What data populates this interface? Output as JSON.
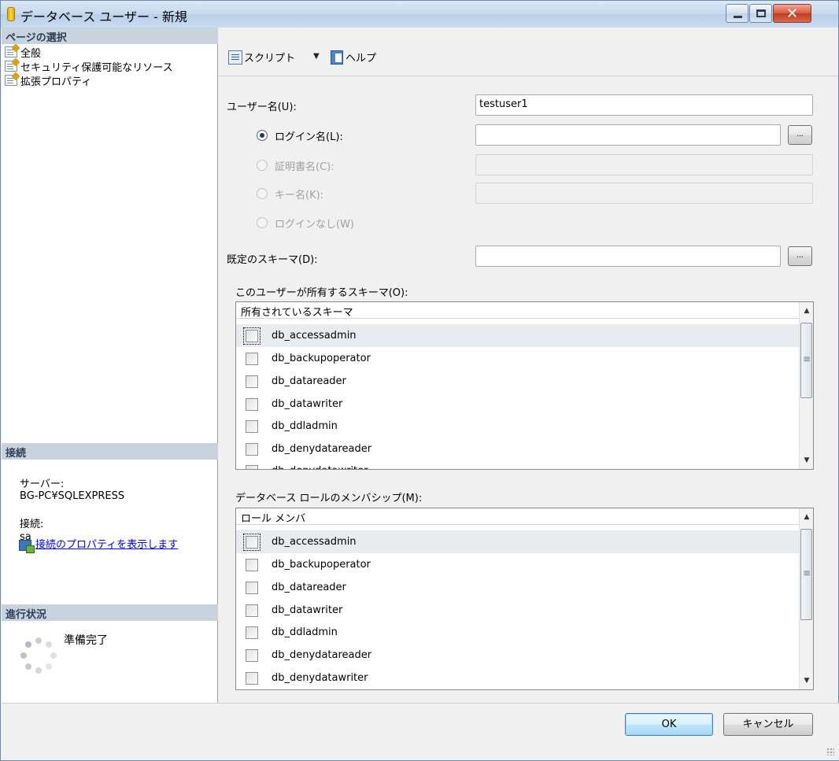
{
  "window": {
    "title": "データベース ユーザー - 新規"
  },
  "left": {
    "pages_header": "ページの選択",
    "pages": [
      {
        "label": "全般"
      },
      {
        "label": "セキュリティ保護可能なリソース"
      },
      {
        "label": "拡張プロパティ"
      }
    ],
    "connection_header": "接続",
    "server_label": "サーバー:",
    "server_value": "BG-PC¥SQLEXPRESS",
    "connection_label": "接続:",
    "connection_value": "sa",
    "view_connection_link": "接続のプロパティを表示します",
    "progress_header": "進行状況",
    "progress_status": "準備完了"
  },
  "toolbar": {
    "script_label": "スクリプト",
    "help_label": "ヘルプ"
  },
  "form": {
    "username_label": "ユーザー名(U):",
    "username_value": "testuser1",
    "login_name_label": "ログイン名(L):",
    "login_name_value": "",
    "cert_name_label": "証明書名(C):",
    "key_name_label": "キー名(K):",
    "no_login_label": "ログインなし(W)",
    "default_schema_label": "既定のスキーマ(D):",
    "default_schema_value": "",
    "browse_label": "...",
    "owned_schemas_label": "このユーザーが所有するスキーマ(O):",
    "owned_schemas_header": "所有されているスキーマ",
    "owned_schemas": [
      {
        "name": "db_accessadmin",
        "checked": false
      },
      {
        "name": "db_backupoperator",
        "checked": false
      },
      {
        "name": "db_datareader",
        "checked": false
      },
      {
        "name": "db_datawriter",
        "checked": false
      },
      {
        "name": "db_ddladmin",
        "checked": false
      },
      {
        "name": "db_denydatareader",
        "checked": false
      },
      {
        "name": "db_denydatawriter",
        "checked": false
      }
    ],
    "role_membership_label": "データベース ロールのメンバシップ(M):",
    "role_membership_header": "ロール メンバ",
    "role_members": [
      {
        "name": "db_accessadmin",
        "checked": false
      },
      {
        "name": "db_backupoperator",
        "checked": false
      },
      {
        "name": "db_datareader",
        "checked": false
      },
      {
        "name": "db_datawriter",
        "checked": false
      },
      {
        "name": "db_ddladmin",
        "checked": false
      },
      {
        "name": "db_denydatareader",
        "checked": false
      },
      {
        "name": "db_denydatawriter",
        "checked": false
      }
    ]
  },
  "buttons": {
    "ok": "OK",
    "cancel": "キャンセル"
  }
}
